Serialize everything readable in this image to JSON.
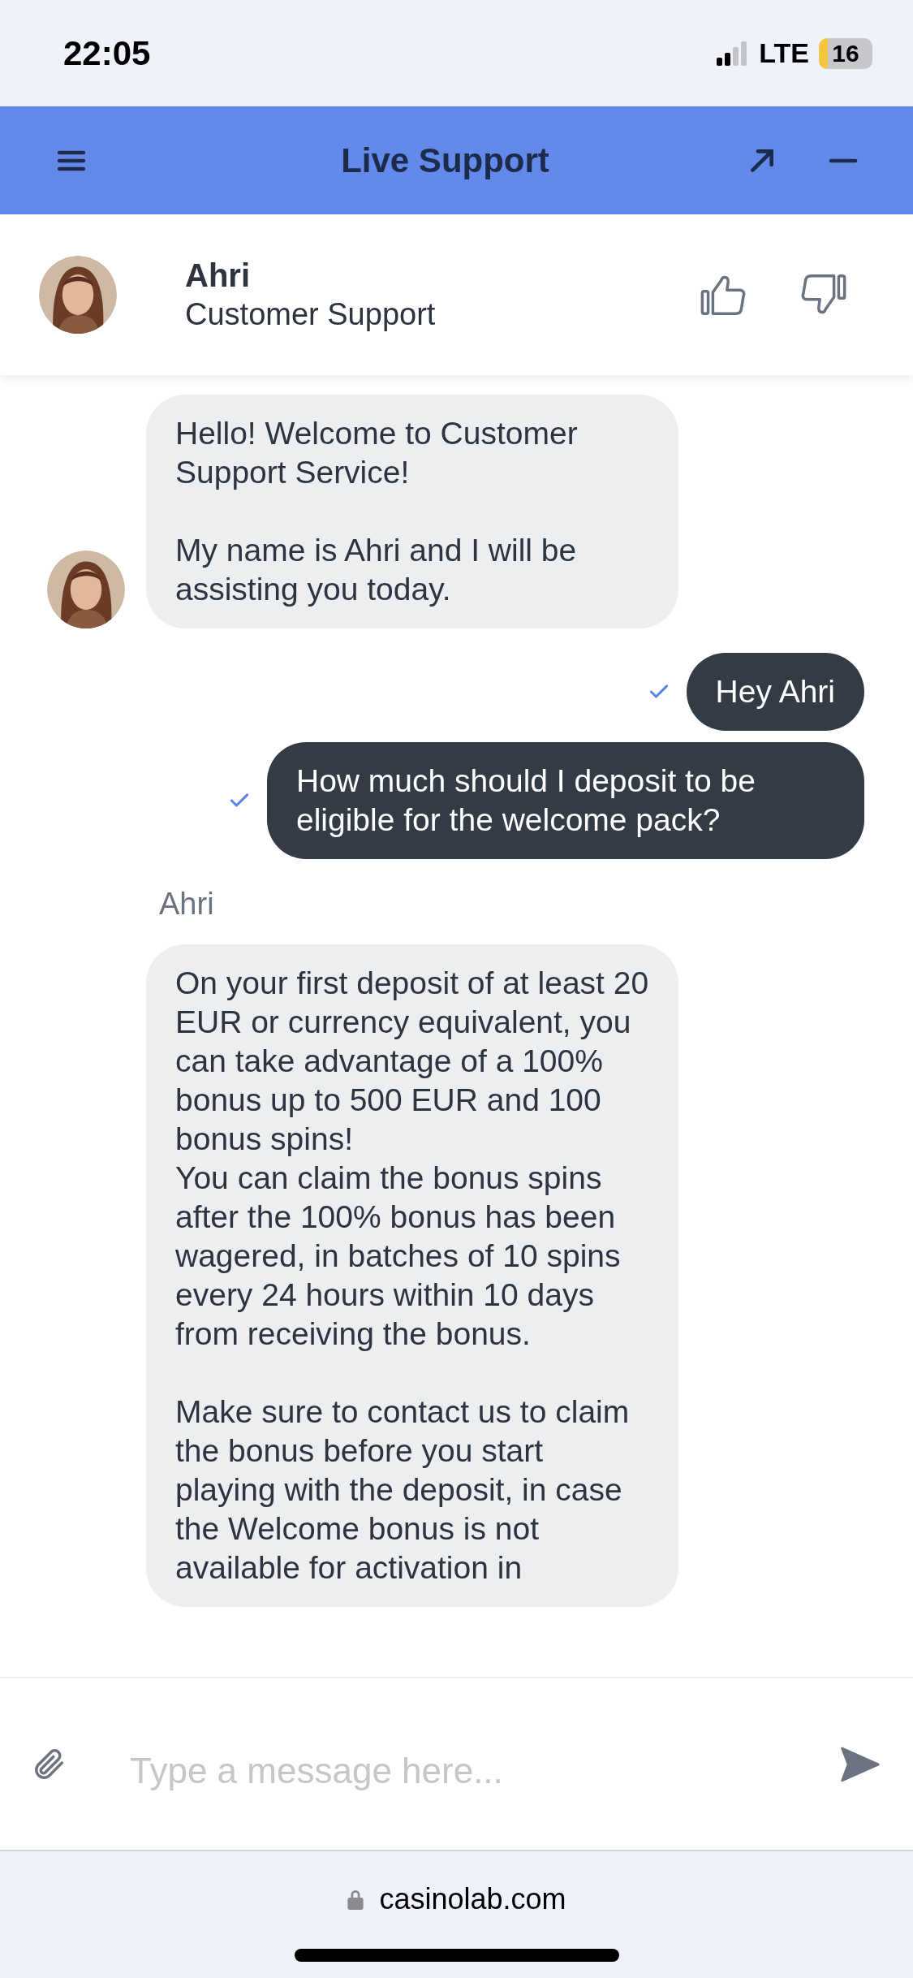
{
  "status_bar": {
    "time": "22:05",
    "network": "LTE",
    "battery": "16"
  },
  "header": {
    "title": "Live Support"
  },
  "agent": {
    "name": "Ahri",
    "role": "Customer Support"
  },
  "messages": [
    {
      "kind": "agent",
      "avatar": true,
      "text": "Hello! Welcome to Customer Support Service!\n\nMy name is Ahri and I will be assisting you today."
    },
    {
      "kind": "user",
      "delivered": true,
      "text": "Hey Ahri"
    },
    {
      "kind": "user",
      "delivered": true,
      "text": "How much should I deposit to be eligible for the welcome pack?"
    },
    {
      "kind": "agent",
      "avatar": false,
      "sender": "Ahri",
      "text": "On your first deposit of at least 20 EUR or currency equivalent, you can take advantage of a 100% bonus up to 500 EUR and 100 bonus spins!\nYou can claim the bonus spins after the 100% bonus has been wagered, in batches of 10 spins every 24 hours within 10 days from receiving the bonus.\n\nMake sure to contact us to claim the bonus before you start playing with the deposit, in case the Welcome bonus is not available for activation in"
    }
  ],
  "composer": {
    "placeholder": "Type a message here..."
  },
  "browser": {
    "url": "casinolab.com"
  }
}
